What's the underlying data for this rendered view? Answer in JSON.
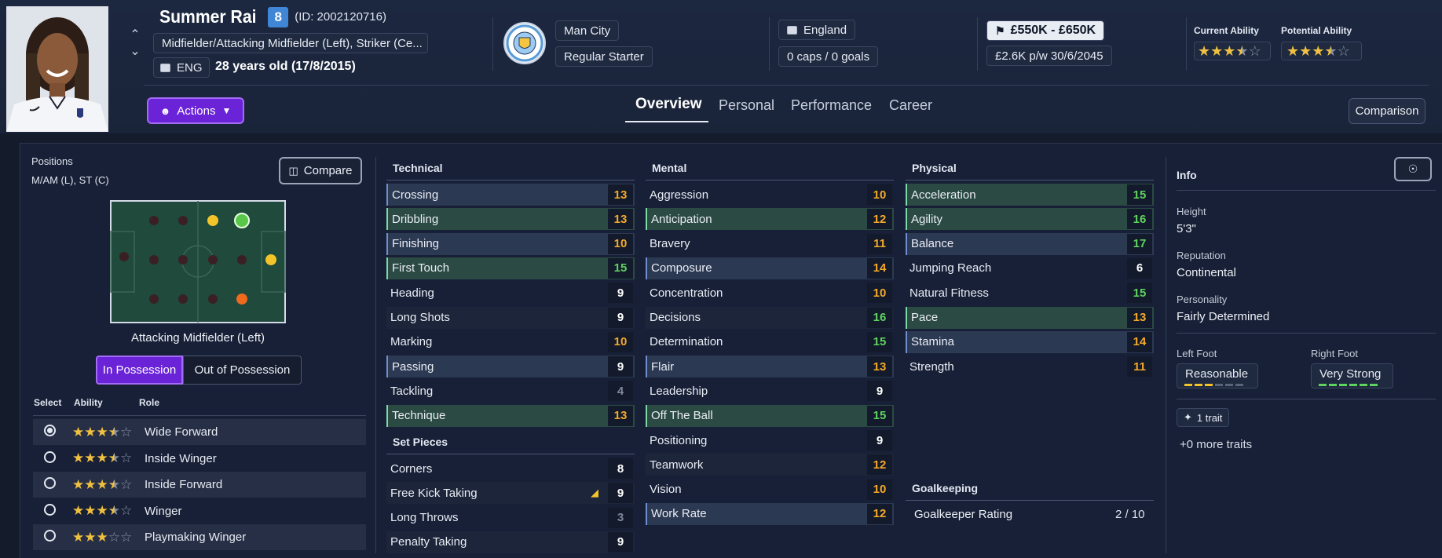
{
  "player": {
    "name": "Summer Rai",
    "squad_number": "8",
    "id_text": "(ID: 2002120716)",
    "positions_text": "Midfielder/Attacking Midfielder (Left), Striker (Ce...",
    "nationality_code": "ENG",
    "age_text": "28 years old (17/8/2015)"
  },
  "club": {
    "name": "Man City",
    "status": "Regular Starter"
  },
  "nation": {
    "name": "England",
    "caps_text": "0 caps / 0 goals"
  },
  "contract": {
    "value_range": "£550K - £650K",
    "wage_text": "£2.6K p/w 30/6/2045"
  },
  "ability": {
    "current_label": "Current Ability",
    "potential_label": "Potential Ability",
    "current_stars": 3.5,
    "potential_stars": 3.5
  },
  "actions_label": "Actions",
  "tabs": [
    {
      "label": "Overview",
      "active": true
    },
    {
      "label": "Personal",
      "active": false
    },
    {
      "label": "Performance",
      "active": false
    },
    {
      "label": "Career",
      "active": false
    }
  ],
  "comparison_label": "Comparison",
  "positions_panel": {
    "title": "Positions",
    "value": "M/AM (L), ST (C)",
    "compare_label": "Compare",
    "selected_position": "Attacking Midfielder (Left)",
    "in_possession": "In Possession",
    "out_possession": "Out of Possession",
    "col_select": "Select",
    "col_ability": "Ability",
    "col_role": "Role",
    "roles": [
      {
        "name": "Wide Forward",
        "stars": 3.5,
        "selected": true
      },
      {
        "name": "Inside Winger",
        "stars": 3.5,
        "selected": false
      },
      {
        "name": "Inside Forward",
        "stars": 3.5,
        "selected": false
      },
      {
        "name": "Winger",
        "stars": 3.5,
        "selected": false
      },
      {
        "name": "Playmaking Winger",
        "stars": 3,
        "selected": false
      }
    ]
  },
  "technical": {
    "title": "Technical",
    "attrs": [
      {
        "name": "Crossing",
        "value": "13",
        "hl": "blue",
        "color": "orange"
      },
      {
        "name": "Dribbling",
        "value": "13",
        "hl": "green",
        "color": "orange"
      },
      {
        "name": "Finishing",
        "value": "10",
        "hl": "blue",
        "color": "orange"
      },
      {
        "name": "First Touch",
        "value": "15",
        "hl": "green",
        "color": "green"
      },
      {
        "name": "Heading",
        "value": "9",
        "hl": "plain",
        "color": "white"
      },
      {
        "name": "Long Shots",
        "value": "9",
        "hl": "stripe",
        "color": "white"
      },
      {
        "name": "Marking",
        "value": "10",
        "hl": "plain",
        "color": "orange"
      },
      {
        "name": "Passing",
        "value": "9",
        "hl": "blue",
        "color": "white"
      },
      {
        "name": "Tackling",
        "value": "4",
        "hl": "plain",
        "color": "gray"
      },
      {
        "name": "Technique",
        "value": "13",
        "hl": "green",
        "color": "orange"
      }
    ]
  },
  "set_pieces": {
    "title": "Set Pieces",
    "attrs": [
      {
        "name": "Corners",
        "value": "8",
        "hl": "plain",
        "color": "white"
      },
      {
        "name": "Free Kick Taking",
        "value": "9",
        "hl": "stripe",
        "color": "white",
        "icon": true
      },
      {
        "name": "Long Throws",
        "value": "3",
        "hl": "plain",
        "color": "gray"
      },
      {
        "name": "Penalty Taking",
        "value": "9",
        "hl": "stripe",
        "color": "white"
      }
    ]
  },
  "mental": {
    "title": "Mental",
    "attrs": [
      {
        "name": "Aggression",
        "value": "10",
        "hl": "plain",
        "color": "orange"
      },
      {
        "name": "Anticipation",
        "value": "12",
        "hl": "green",
        "color": "orange"
      },
      {
        "name": "Bravery",
        "value": "11",
        "hl": "plain",
        "color": "orange"
      },
      {
        "name": "Composure",
        "value": "14",
        "hl": "blue",
        "color": "orange"
      },
      {
        "name": "Concentration",
        "value": "10",
        "hl": "plain",
        "color": "orange"
      },
      {
        "name": "Decisions",
        "value": "16",
        "hl": "stripe",
        "color": "green"
      },
      {
        "name": "Determination",
        "value": "15",
        "hl": "plain",
        "color": "green"
      },
      {
        "name": "Flair",
        "value": "13",
        "hl": "blue",
        "color": "orange"
      },
      {
        "name": "Leadership",
        "value": "9",
        "hl": "plain",
        "color": "white"
      },
      {
        "name": "Off The Ball",
        "value": "15",
        "hl": "green",
        "color": "green"
      },
      {
        "name": "Positioning",
        "value": "9",
        "hl": "plain",
        "color": "white"
      },
      {
        "name": "Teamwork",
        "value": "12",
        "hl": "stripe",
        "color": "orange"
      },
      {
        "name": "Vision",
        "value": "10",
        "hl": "plain",
        "color": "orange"
      },
      {
        "name": "Work Rate",
        "value": "12",
        "hl": "blue",
        "color": "orange"
      }
    ]
  },
  "physical": {
    "title": "Physical",
    "attrs": [
      {
        "name": "Acceleration",
        "value": "15",
        "hl": "green",
        "color": "green"
      },
      {
        "name": "Agility",
        "value": "16",
        "hl": "green",
        "color": "green"
      },
      {
        "name": "Balance",
        "value": "17",
        "hl": "blue",
        "color": "green"
      },
      {
        "name": "Jumping Reach",
        "value": "6",
        "hl": "plain",
        "color": "white"
      },
      {
        "name": "Natural Fitness",
        "value": "15",
        "hl": "plain",
        "color": "green"
      },
      {
        "name": "Pace",
        "value": "13",
        "hl": "green",
        "color": "orange"
      },
      {
        "name": "Stamina",
        "value": "14",
        "hl": "blue",
        "color": "orange"
      },
      {
        "name": "Strength",
        "value": "11",
        "hl": "plain",
        "color": "orange"
      }
    ]
  },
  "goalkeeping": {
    "title": "Goalkeeping",
    "rating_label": "Goalkeeper Rating",
    "rating_value": "2 / 10"
  },
  "info": {
    "title": "Info",
    "height_label": "Height",
    "height": "5'3\"",
    "reputation_label": "Reputation",
    "reputation": "Continental",
    "personality_label": "Personality",
    "personality": "Fairly Determined",
    "left_foot_label": "Left Foot",
    "left_foot": "Reasonable",
    "left_foot_level": 3,
    "right_foot_label": "Right Foot",
    "right_foot": "Very Strong",
    "right_foot_level": 6,
    "traits_label": "1 trait",
    "more_traits": "+0 more traits"
  },
  "colors": {
    "accent_purple": "#7a2fe0",
    "green": "#5fd35f",
    "orange": "#f6a928",
    "star": "#f0c040"
  }
}
